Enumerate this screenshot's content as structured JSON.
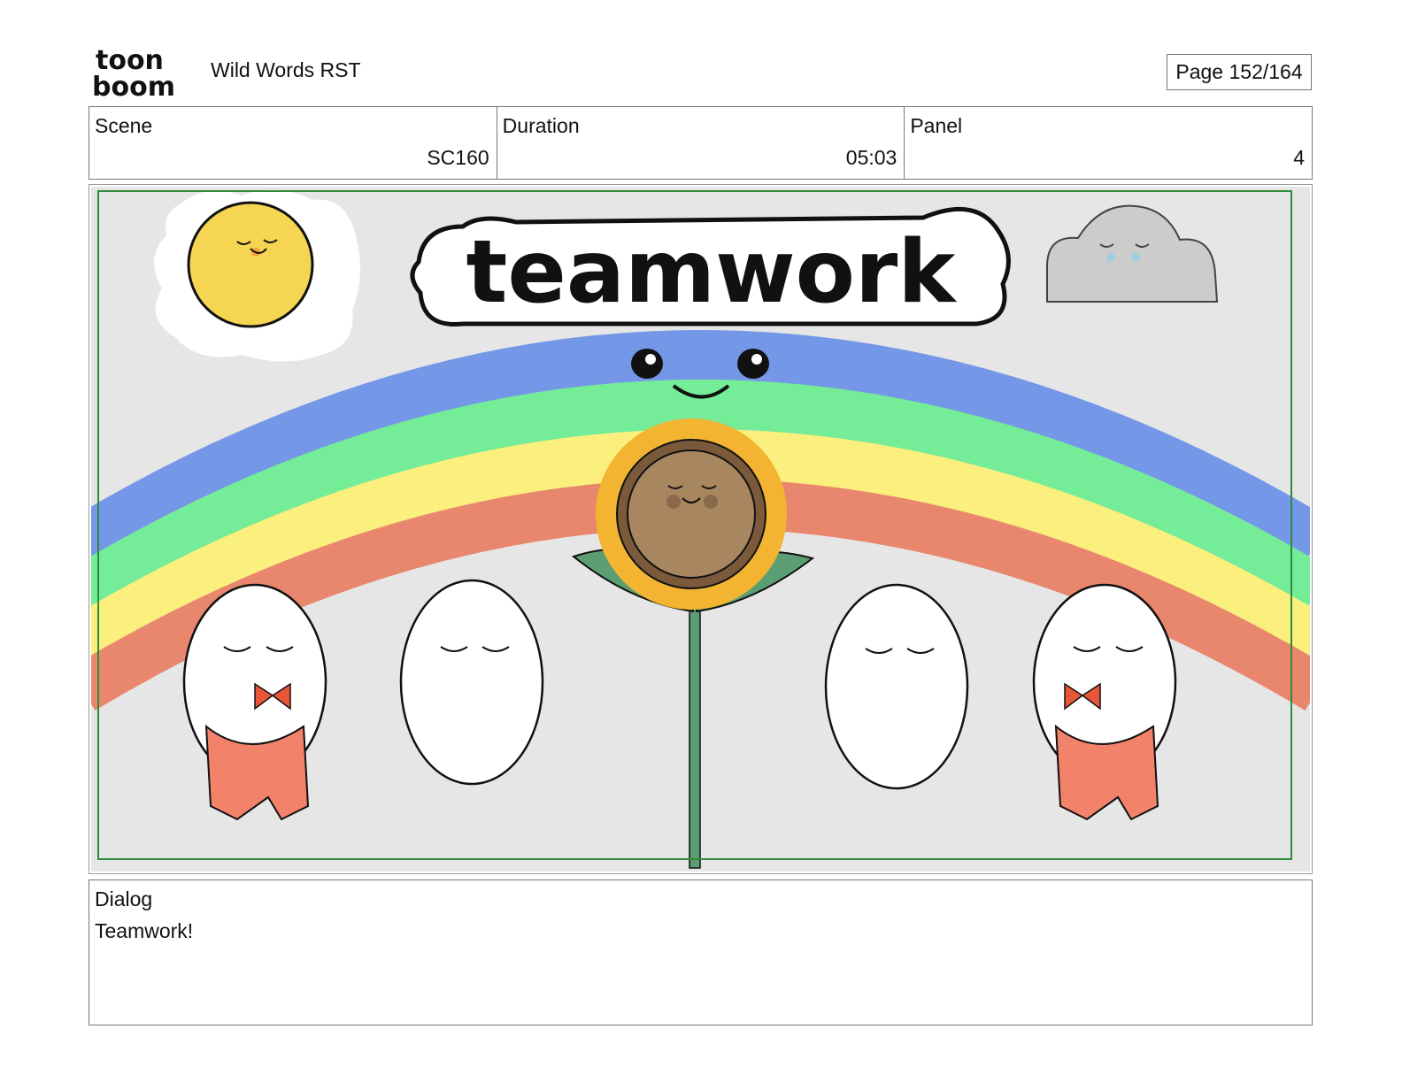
{
  "header": {
    "logo_top": "toon",
    "logo_bottom": "boom",
    "project_title": "Wild Words RST",
    "page_label": "Page 152/164"
  },
  "info": {
    "scene_label": "Scene",
    "scene_value": "SC160",
    "duration_label": "Duration",
    "duration_value": "05:03",
    "panel_label": "Panel",
    "panel_value": "4"
  },
  "panel": {
    "title_text": "teamwork",
    "colors": {
      "background": "#e6e6e6",
      "safe_frame": "#2e8b3a",
      "rainbow_blue": "#7497e8",
      "rainbow_green": "#74ec98",
      "rainbow_yellow": "#fbef7d",
      "rainbow_red": "#e8876e",
      "sun": "#f6d552",
      "cloud": "#cccccc",
      "sunflower_petals": "#f3b431",
      "sunflower_center": "#a88760",
      "leaves": "#5c9e73",
      "pants": "#f3826a"
    }
  },
  "dialog": {
    "label": "Dialog",
    "text": "Teamwork!"
  }
}
